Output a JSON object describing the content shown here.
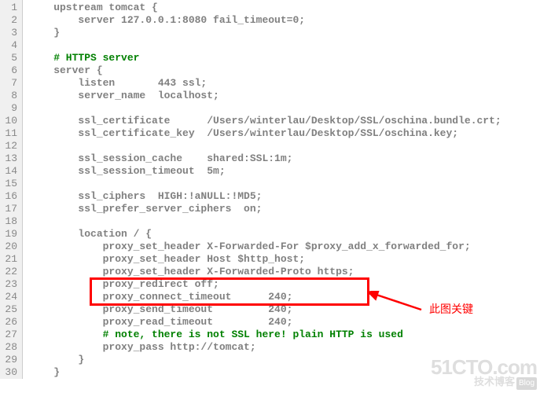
{
  "lines": [
    {
      "n": 1,
      "t": "    upstream tomcat {",
      "cls": ""
    },
    {
      "n": 2,
      "t": "        server 127.0.0.1:8080 fail_timeout=0;",
      "cls": ""
    },
    {
      "n": 3,
      "t": "    }",
      "cls": ""
    },
    {
      "n": 4,
      "t": "",
      "cls": ""
    },
    {
      "n": 5,
      "t": "    # HTTPS server",
      "cls": "comment"
    },
    {
      "n": 6,
      "t": "    server {",
      "cls": ""
    },
    {
      "n": 7,
      "t": "        listen       443 ssl;",
      "cls": ""
    },
    {
      "n": 8,
      "t": "        server_name  localhost;",
      "cls": ""
    },
    {
      "n": 9,
      "t": "",
      "cls": ""
    },
    {
      "n": 10,
      "t": "        ssl_certificate      /Users/winterlau/Desktop/SSL/oschina.bundle.crt;",
      "cls": ""
    },
    {
      "n": 11,
      "t": "        ssl_certificate_key  /Users/winterlau/Desktop/SSL/oschina.key;",
      "cls": ""
    },
    {
      "n": 12,
      "t": "",
      "cls": ""
    },
    {
      "n": 13,
      "t": "        ssl_session_cache    shared:SSL:1m;",
      "cls": ""
    },
    {
      "n": 14,
      "t": "        ssl_session_timeout  5m;",
      "cls": ""
    },
    {
      "n": 15,
      "t": "",
      "cls": ""
    },
    {
      "n": 16,
      "t": "        ssl_ciphers  HIGH:!aNULL:!MD5;",
      "cls": ""
    },
    {
      "n": 17,
      "t": "        ssl_prefer_server_ciphers  on;",
      "cls": ""
    },
    {
      "n": 18,
      "t": "",
      "cls": ""
    },
    {
      "n": 19,
      "t": "        location / {",
      "cls": ""
    },
    {
      "n": 20,
      "t": "            proxy_set_header X-Forwarded-For $proxy_add_x_forwarded_for;",
      "cls": ""
    },
    {
      "n": 21,
      "t": "            proxy_set_header Host $http_host;",
      "cls": ""
    },
    {
      "n": 22,
      "t": "            proxy_set_header X-Forwarded-Proto https;",
      "cls": ""
    },
    {
      "n": 23,
      "t": "            proxy_redirect off;",
      "cls": ""
    },
    {
      "n": 24,
      "t": "            proxy_connect_timeout      240;",
      "cls": ""
    },
    {
      "n": 25,
      "t": "            proxy_send_timeout         240;",
      "cls": ""
    },
    {
      "n": 26,
      "t": "            proxy_read_timeout         240;",
      "cls": ""
    },
    {
      "n": 27,
      "t": "            # note, there is not SSL here! plain HTTP is used",
      "cls": "comment"
    },
    {
      "n": 28,
      "t": "            proxy_pass http://tomcat;",
      "cls": ""
    },
    {
      "n": 29,
      "t": "        }",
      "cls": ""
    },
    {
      "n": 30,
      "t": "    }",
      "cls": ""
    }
  ],
  "annotation_text": "此图关键",
  "watermark_big": "51CTO.com",
  "watermark_small": "技术博客",
  "watermark_tag": "Blog"
}
